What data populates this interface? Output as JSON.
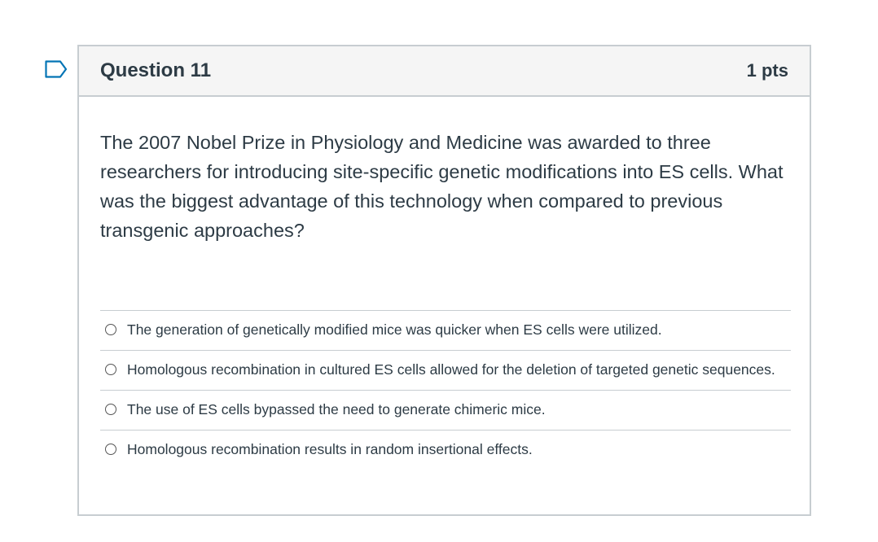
{
  "question": {
    "title": "Question 11",
    "points": "1 pts",
    "text": "The 2007 Nobel Prize in Physiology and Medicine was awarded to three researchers for introducing site-specific genetic modifications into ES cells. What was the biggest advantage of this technology when compared to previous transgenic approaches?",
    "flag_icon": "flag-bookmark-icon"
  },
  "answers": [
    {
      "label": "The generation of genetically modified mice was quicker when ES cells were utilized.",
      "selected": false
    },
    {
      "label": "Homologous recombination in cultured ES cells allowed for the deletion of targeted genetic sequences.",
      "selected": false
    },
    {
      "label": "The use of ES cells bypassed the need to generate chimeric mice.",
      "selected": false
    },
    {
      "label": "Homologous recombination results in random insertional effects.",
      "selected": false
    }
  ],
  "colors": {
    "text": "#2d3b45",
    "border": "#c7cdd1",
    "header_bg": "#f5f5f5",
    "flag": "#0374b5"
  }
}
